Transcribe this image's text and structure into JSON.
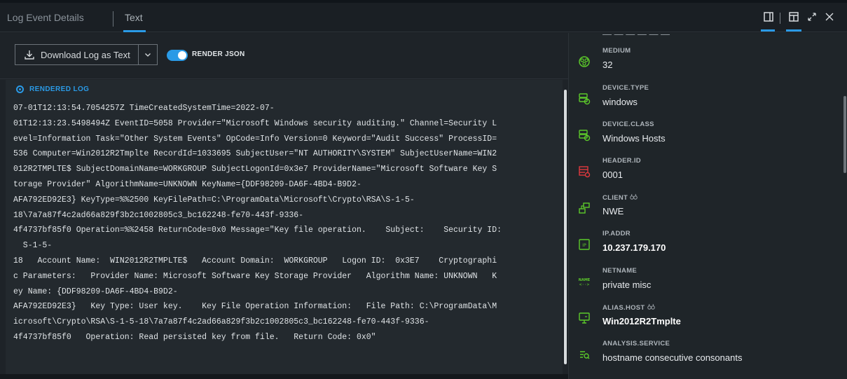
{
  "header": {
    "tab_log": "Log Event Details",
    "tab_text": "Text",
    "icons": [
      "split-view-icon",
      "window-icon",
      "expand-icon",
      "close-icon"
    ]
  },
  "toolbar": {
    "download_label": "Download Log as Text",
    "toggle_label": "RENDER JSON",
    "toggle_on": true
  },
  "rendered_log": {
    "label": "RENDERED LOG",
    "lines": [
      "07-01T12:13:54.7054257Z TimeCreatedSystemTime=2022-07-",
      "01T12:13:23.5498494Z EventID=5058 Provider=\"Microsoft Windows security auditing.\" Channel=Security L",
      "evel=Information Task=\"Other System Events\" OpCode=Info Version=0 Keyword=\"Audit Success\" ProcessID=",
      "536 Computer=Win2012R2Tmplte RecordId=1033695 SubjectUser=\"NT AUTHORITY\\SYSTEM\" SubjectUserName=WIN2",
      "012R2TMPLTE$ SubjectDomainName=WORKGROUP SubjectLogonId=0x3e7 ProviderName=\"Microsoft Software Key S",
      "torage Provider\" AlgorithmName=UNKNOWN KeyName={DDF98209-DA6F-4BD4-B9D2-",
      "AFA792ED92E3} KeyType=%%2500 KeyFilePath=C:\\ProgramData\\Microsoft\\Crypto\\RSA\\S-1-5-",
      "18\\7a7a87f4c2ad66a829f3b2c1002805c3_bc162248-fe70-443f-9336-",
      "4f4737bf85f0 Operation=%%2458 ReturnCode=0x0 Message=\"Key file operation.    Subject:    Security ID:",
      "  S-1-5-",
      "18   Account Name:  WIN2012R2TMPLTE$   Account Domain:  WORKGROUP   Logon ID:  0x3E7    Cryptographi",
      "c Parameters:   Provider Name: Microsoft Software Key Storage Provider   Algorithm Name: UNKNOWN   K",
      "ey Name: {DDF98209-DA6F-4BD4-B9D2-",
      "AFA792ED92E3}   Key Type: User key.    Key File Operation Information:   File Path: C:\\ProgramData\\M",
      "icrosoft\\Crypto\\RSA\\S-1-5-18\\7a7a87f4c2ad66a829f3b2c1002805c3_bc162248-fe70-443f-9336-",
      "4f4737bf85f0   Operation: Read persisted key from file.   Return Code: 0x0\""
    ]
  },
  "fields": [
    {
      "label": "MEDIUM",
      "value": "32",
      "icon": "medium-icon",
      "color": "#5cc92a"
    },
    {
      "label": "DEVICE.TYPE",
      "value": "windows",
      "icon": "device-type-icon",
      "color": "#5cc92a"
    },
    {
      "label": "DEVICE.CLASS",
      "value": "Windows Hosts",
      "icon": "device-class-icon",
      "color": "#5cc92a"
    },
    {
      "label": "HEADER.ID",
      "value": "0001",
      "icon": "header-id-icon",
      "color": "#e0393e"
    },
    {
      "label": "CLIENT",
      "value": "NWE",
      "icon": "client-icon",
      "color": "#5cc92a"
    },
    {
      "label": "IP.ADDR",
      "value": "10.237.179.170",
      "icon": "ip-addr-icon",
      "color": "#5cc92a"
    },
    {
      "label": "NETNAME",
      "value": "private misc",
      "icon": "netname-icon",
      "color": "#5cc92a"
    },
    {
      "label": "ALIAS.HOST",
      "value": "Win2012R2Tmplte",
      "icon": "alias-host-icon",
      "color": "#5cc92a"
    },
    {
      "label": "ANALYSIS.SERVICE",
      "value": "hostname consecutive consonants",
      "icon": "analysis-service-icon",
      "color": "#5cc92a"
    }
  ],
  "colors": {
    "accent": "#2a9ae6",
    "green": "#5cc92a",
    "red": "#e0393e"
  }
}
